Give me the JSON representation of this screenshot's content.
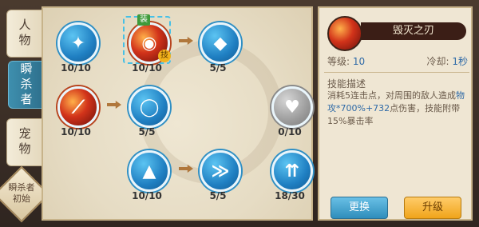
{
  "tabs": [
    {
      "label": "人物",
      "active": false
    },
    {
      "label": "瞬杀者",
      "active": true
    },
    {
      "label": "宠物",
      "active": false
    }
  ],
  "class_badge": {
    "line1": "瞬杀者",
    "line2": "初始"
  },
  "tree": {
    "nodes": [
      {
        "id": "n1",
        "icon": "shield-icon",
        "count": "10/10"
      },
      {
        "id": "n2",
        "icon": "red-skill-icon",
        "count": "10/10",
        "equip_tag": "装",
        "skill_tag": "技"
      },
      {
        "id": "n3",
        "icon": "diamond-icon",
        "count": "5/5"
      },
      {
        "id": "n4",
        "icon": "slash-icon",
        "count": "10/10"
      },
      {
        "id": "n5",
        "icon": "ring-icon",
        "count": "5/5"
      },
      {
        "id": "n6",
        "icon": "heart-plus-icon",
        "count": "0/10"
      },
      {
        "id": "n7",
        "icon": "up-plus-icon",
        "count": "10/10"
      },
      {
        "id": "n8",
        "icon": "wing-icon",
        "count": "5/5"
      },
      {
        "id": "n9",
        "icon": "double-up-icon",
        "count": "18/30"
      }
    ]
  },
  "info": {
    "skill_name": "毁灭之刃",
    "level_label": "等级:",
    "level_value": "10",
    "cooldown_label": "冷却:",
    "cooldown_value": "1秒",
    "desc_title": "技能描述",
    "desc_part1": "消耗5连击点，对周围的敌人造成",
    "desc_highlight": "物攻*700%+732",
    "desc_part2": "点伤害，技能附带15%暴击率",
    "btn_swap": "更换",
    "btn_upgrade": "升级"
  },
  "colors": {
    "accent_blue": "#2f8dbb",
    "accent_gold": "#f0a41a",
    "highlight_text": "#2f6aa7"
  }
}
